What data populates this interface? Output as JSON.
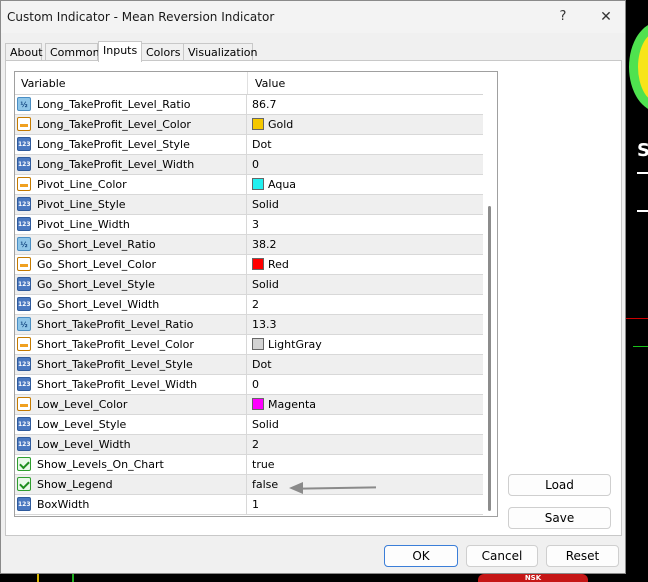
{
  "window": {
    "title": "Custom Indicator - Mean Reversion Indicator",
    "help_glyph": "?",
    "close_glyph": "✕"
  },
  "tabs": [
    {
      "label": "About",
      "active": false
    },
    {
      "label": "Common",
      "active": false
    },
    {
      "label": "Inputs",
      "active": true
    },
    {
      "label": "Colors",
      "active": false
    },
    {
      "label": "Visualization",
      "active": false
    }
  ],
  "grid": {
    "headers": {
      "variable": "Variable",
      "value": "Value"
    },
    "rows": [
      {
        "name": "Long_TakeProfit_Level_Ratio",
        "value": "86.7",
        "icon": "frac-icon"
      },
      {
        "name": "Long_TakeProfit_Level_Color",
        "value": "Gold",
        "icon": "color-icon",
        "swatch": "#f5c800"
      },
      {
        "name": "Long_TakeProfit_Level_Style",
        "value": "Dot",
        "icon": "number-icon"
      },
      {
        "name": "Long_TakeProfit_Level_Width",
        "value": "0",
        "icon": "number-icon"
      },
      {
        "name": "Pivot_Line_Color",
        "value": "Aqua",
        "icon": "color-icon",
        "swatch": "#22f0f0"
      },
      {
        "name": "Pivot_Line_Style",
        "value": "Solid",
        "icon": "number-icon"
      },
      {
        "name": "Pivot_Line_Width",
        "value": "3",
        "icon": "number-icon"
      },
      {
        "name": "Go_Short_Level_Ratio",
        "value": "38.2",
        "icon": "frac-icon"
      },
      {
        "name": "Go_Short_Level_Color",
        "value": "Red",
        "icon": "color-icon",
        "swatch": "#ff0000"
      },
      {
        "name": "Go_Short_Level_Style",
        "value": "Solid",
        "icon": "number-icon"
      },
      {
        "name": "Go_Short_Level_Width",
        "value": "2",
        "icon": "number-icon"
      },
      {
        "name": "Short_TakeProfit_Level_Ratio",
        "value": "13.3",
        "icon": "frac-icon"
      },
      {
        "name": "Short_TakeProfit_Level_Color",
        "value": "LightGray",
        "icon": "color-icon",
        "swatch": "#d3d3d3"
      },
      {
        "name": "Short_TakeProfit_Level_Style",
        "value": "Dot",
        "icon": "number-icon"
      },
      {
        "name": "Short_TakeProfit_Level_Width",
        "value": "0",
        "icon": "number-icon"
      },
      {
        "name": "Low_Level_Color",
        "value": "Magenta",
        "icon": "color-icon",
        "swatch": "#ff00ff"
      },
      {
        "name": "Low_Level_Style",
        "value": "Solid",
        "icon": "number-icon"
      },
      {
        "name": "Low_Level_Width",
        "value": "2",
        "icon": "number-icon"
      },
      {
        "name": "Show_Levels_On_Chart",
        "value": "true",
        "icon": "bool-icon"
      },
      {
        "name": "Show_Legend",
        "value": "false",
        "icon": "bool-icon"
      },
      {
        "name": "BoxWidth",
        "value": "1",
        "icon": "number-icon"
      }
    ]
  },
  "buttons": {
    "load": "Load",
    "save": "Save",
    "ok": "OK",
    "cancel": "Cancel",
    "reset": "Reset"
  },
  "chart_bg": {
    "s_glyph": "S",
    "badge": "NSK"
  }
}
